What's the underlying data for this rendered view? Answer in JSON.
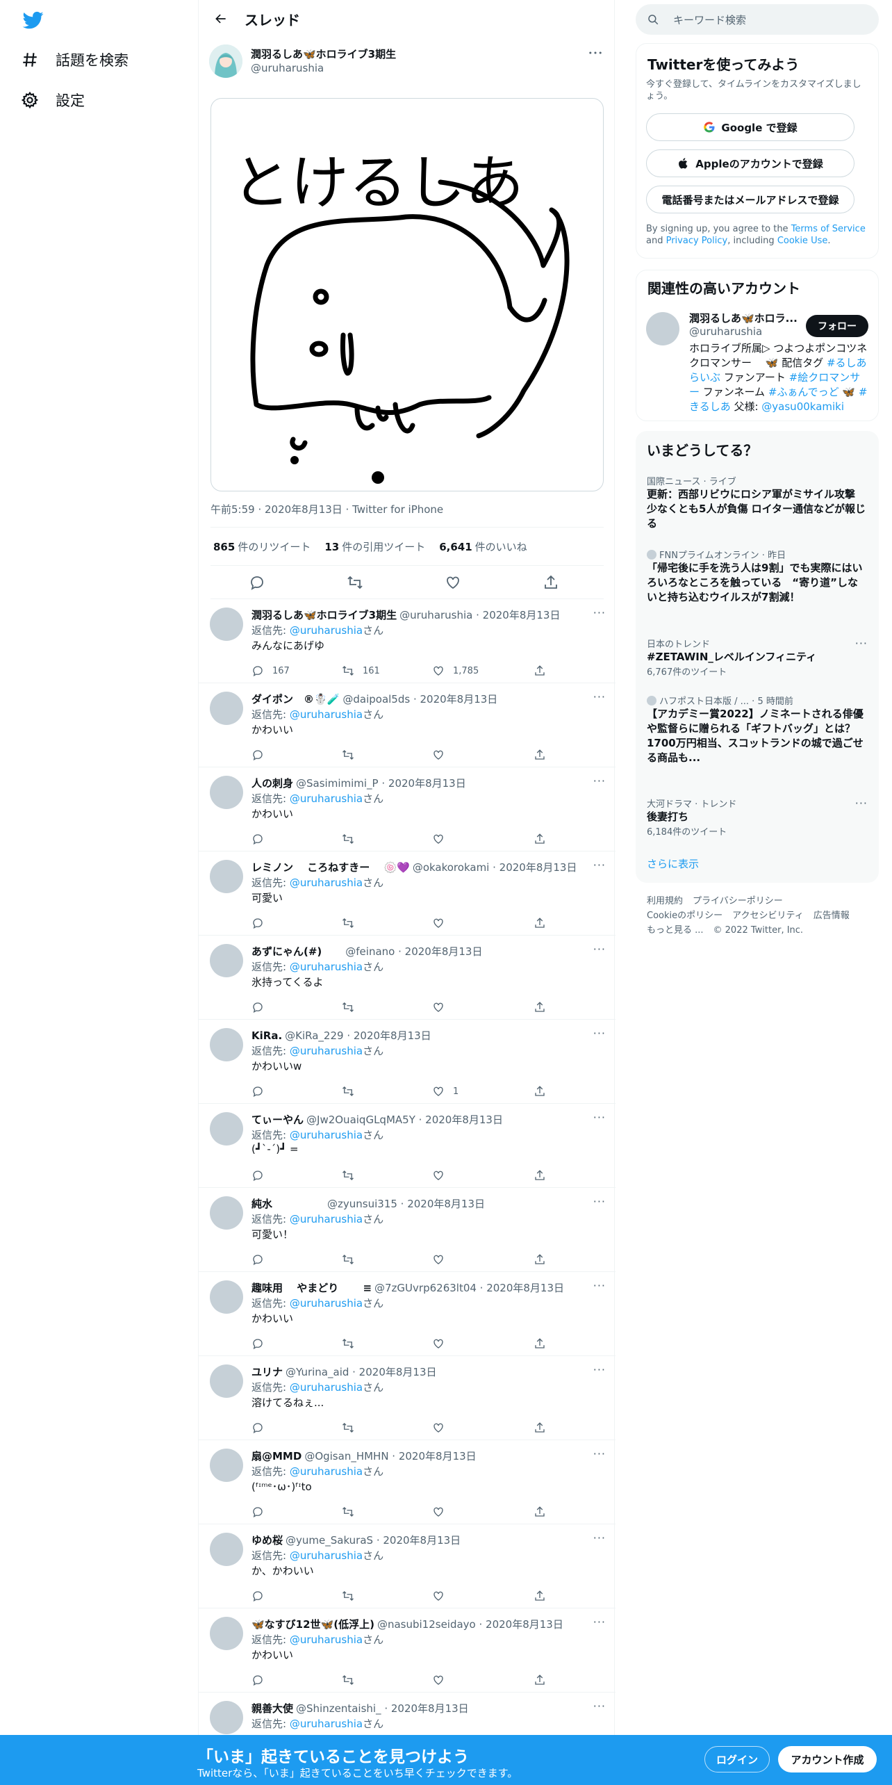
{
  "nav": {
    "explore_label": "話題を検索",
    "settings_label": "設定"
  },
  "header": {
    "title": "スレッド"
  },
  "tweet": {
    "author_name": "潤羽るしあ🦋ホロライブ3期生",
    "author_handle": "@uruharushia",
    "image_text": "とけるしあ",
    "timestamp": "午前5:59 · 2020年8月13日 · Twitter for iPhone",
    "retweets_count": "865",
    "retweets_label": "件のリツイート",
    "quotes_count": "13",
    "quotes_label": "件の引用ツイート",
    "likes_count": "6,641",
    "likes_label": "件のいいね"
  },
  "replies": [
    {
      "name": "潤羽るしあ🦋ホロライブ3期生",
      "handle": "@uruharushia · 2020年8月13日",
      "to_prefix": "返信先: ",
      "to_handle": "@uruharushia",
      "to_suffix": "さん",
      "text": "みんなにあげゆ",
      "replies": "167",
      "retweets": "161",
      "likes": "1,785"
    },
    {
      "name": "ダイポン　®☃️🧪",
      "handle": "@daipoal5ds · 2020年8月13日",
      "to_prefix": "返信先: ",
      "to_handle": "@uruharushia",
      "to_suffix": "さん",
      "text": "かわいい",
      "replies": "",
      "retweets": "",
      "likes": ""
    },
    {
      "name": "人の刺身",
      "handle": "@Sasimimimi_P · 2020年8月13日",
      "to_prefix": "返信先: ",
      "to_handle": "@uruharushia",
      "to_suffix": "さん",
      "text": "かわいい",
      "replies": "",
      "retweets": "",
      "likes": ""
    },
    {
      "name": "レミノン　 ころねすきー　 🍥💜",
      "handle": "@okakorokami · 2020年8月13日",
      "to_prefix": "返信先: ",
      "to_handle": "@uruharushia",
      "to_suffix": "さん",
      "text": "可愛い",
      "replies": "",
      "retweets": "",
      "likes": ""
    },
    {
      "name": "あずにゃん(#)",
      "handle": "　　@feinano · 2020年8月13日",
      "to_prefix": "返信先: ",
      "to_handle": "@uruharushia",
      "to_suffix": "さん",
      "text": "氷持ってくるよ",
      "replies": "",
      "retweets": "",
      "likes": ""
    },
    {
      "name": "KiRa.",
      "handle": "@KiRa_229 · 2020年8月13日",
      "to_prefix": "返信先: ",
      "to_handle": "@uruharushia",
      "to_suffix": "さん",
      "text": "かわいいw",
      "replies": "",
      "retweets": "",
      "likes": "1"
    },
    {
      "name": "てぃーやん",
      "handle": "@Jw2OuaiqGLqMA5Y · 2020年8月13日",
      "to_prefix": "返信先: ",
      "to_handle": "@uruharushia",
      "to_suffix": "さん",
      "text": "(┛`-´)┛ =",
      "replies": "",
      "retweets": "",
      "likes": ""
    },
    {
      "name": "純水",
      "handle": "　　　　　@zyunsui315 · 2020年8月13日",
      "to_prefix": "返信先: ",
      "to_handle": "@uruharushia",
      "to_suffix": "さん",
      "text": "可愛い！",
      "replies": "",
      "retweets": "",
      "likes": ""
    },
    {
      "name": "趣味用　 やまどり　　 ≡",
      "handle": "@7zGUvrp6263lt04 · 2020年8月13日",
      "to_prefix": "返信先: ",
      "to_handle": "@uruharushia",
      "to_suffix": "さん",
      "text": "かわいい",
      "replies": "",
      "retweets": "",
      "likes": ""
    },
    {
      "name": "ユリナ",
      "handle": "@Yurina_aid · 2020年8月13日",
      "to_prefix": "返信先: ",
      "to_handle": "@uruharushia",
      "to_suffix": "さん",
      "text": "溶けてるねぇ...",
      "replies": "",
      "retweets": "",
      "likes": ""
    },
    {
      "name": "扇@MMD",
      "handle": "@Ogisan_HMHN · 2020年8月13日",
      "to_prefix": "返信先: ",
      "to_handle": "@uruharushia",
      "to_suffix": "さん",
      "text": "(ᶠᶦᵐᵉ･ω･)ᶠᶦto",
      "replies": "",
      "retweets": "",
      "likes": ""
    },
    {
      "name": "ゆめ桜",
      "handle": "@yume_SakuraS · 2020年8月13日",
      "to_prefix": "返信先: ",
      "to_handle": "@uruharushia",
      "to_suffix": "さん",
      "text": "か、かわいい",
      "replies": "",
      "retweets": "",
      "likes": ""
    },
    {
      "name": "🦋なすび12世🦋(低浮上)",
      "handle": "@nasubi12seidayo · 2020年8月13日",
      "to_prefix": "返信先: ",
      "to_handle": "@uruharushia",
      "to_suffix": "さん",
      "text": "かわいい",
      "replies": "",
      "retweets": "",
      "likes": ""
    },
    {
      "name": "親善大使",
      "handle": "@Shinzentaishi_ · 2020年8月13日",
      "to_prefix": "返信先: ",
      "to_handle": "@uruharushia",
      "to_suffix": "さん",
      "text": "",
      "replies": "",
      "retweets": "",
      "likes": ""
    }
  ],
  "search": {
    "placeholder": "キーワード検索"
  },
  "signup_card": {
    "title": "Twitterを使ってみよう",
    "subtitle": "今すぐ登録して、タイムラインをカスタマイズしましょう。",
    "google_label": "Google で登録",
    "apple_label": "Appleのアカウントで登録",
    "phone_label": "電話番号またはメールアドレスで登録",
    "legal_1": "By signing up, you agree to the ",
    "terms": "Terms of Service",
    "legal_2": " and ",
    "privacy": "Privacy Policy",
    "legal_3": ", including ",
    "cookie": "Cookie Use",
    "legal_4": "."
  },
  "related": {
    "title": "関連性の高いアカウント",
    "name": "潤羽るしあ🦋ホロラ...",
    "handle": "@uruharushia",
    "follow_label": "フォロー",
    "bio_1": "ホロライブ所属▷ つよつよポンコツネクロマンサー　 🦋 配信タグ ",
    "bio_tag1": "#るしあらいぶ",
    "bio_2": " ファンアート ",
    "bio_tag2": "#絵クロマンサー",
    "bio_3": " ファンネーム ",
    "bio_tag3": "#ふぁんでっど",
    "bio_4": " 🦋 ",
    "bio_tag4": "#きるしあ",
    "bio_5": " 父様: ",
    "bio_dad": "@yasu00kamiki"
  },
  "trends": {
    "title": "いまどうしてる？",
    "items": [
      {
        "meta": "国際ニュース · ライブ",
        "title": "更新：西部リビウにロシア軍がミサイル攻撃 少なくとも5人が負傷 ロイター通信などが報じる",
        "count": ""
      },
      {
        "meta": "FNNプライムオンライン · 昨日",
        "title": "「帰宅後に手を洗う人は9割」でも実際にはいろいろなところを触っている　“寄り道”しないと持ち込むウイルスが7割減！",
        "count": ""
      },
      {
        "meta": "日本のトレンド",
        "title": "#ZETAWIN_レベルインフィニティ",
        "count": "6,767件のツイート"
      },
      {
        "meta": "ハフポスト日本版 / ... · 5 時間前",
        "title": "【アカデミー賞2022】ノミネートされる俳優や監督らに贈られる「ギフトバッグ」とは？1700万円相当、スコットランドの城で過ごせる商品も...",
        "count": ""
      },
      {
        "meta": "大河ドラマ · トレンド",
        "title": "後妻打ち",
        "count": "6,184件のツイート"
      }
    ],
    "more_label": "さらに表示"
  },
  "footer": {
    "terms": "利用規約",
    "privacy": "プライバシーポリシー",
    "cookie": "Cookieのポリシー",
    "accessibility": "アクセシビリティ",
    "ads": "広告情報",
    "more": "もっと見る ...",
    "copyright": "© 2022 Twitter, Inc."
  },
  "banner": {
    "title": "「いま」起きていることを見つけよう",
    "subtitle": "Twitterなら、「いま」起きていることをいち早くチェックできます。",
    "login_label": "ログイン",
    "signup_label": "アカウント作成"
  },
  "colors": {
    "accent": "#1d9bf0",
    "text": "#0f1419",
    "muted": "#536471"
  }
}
